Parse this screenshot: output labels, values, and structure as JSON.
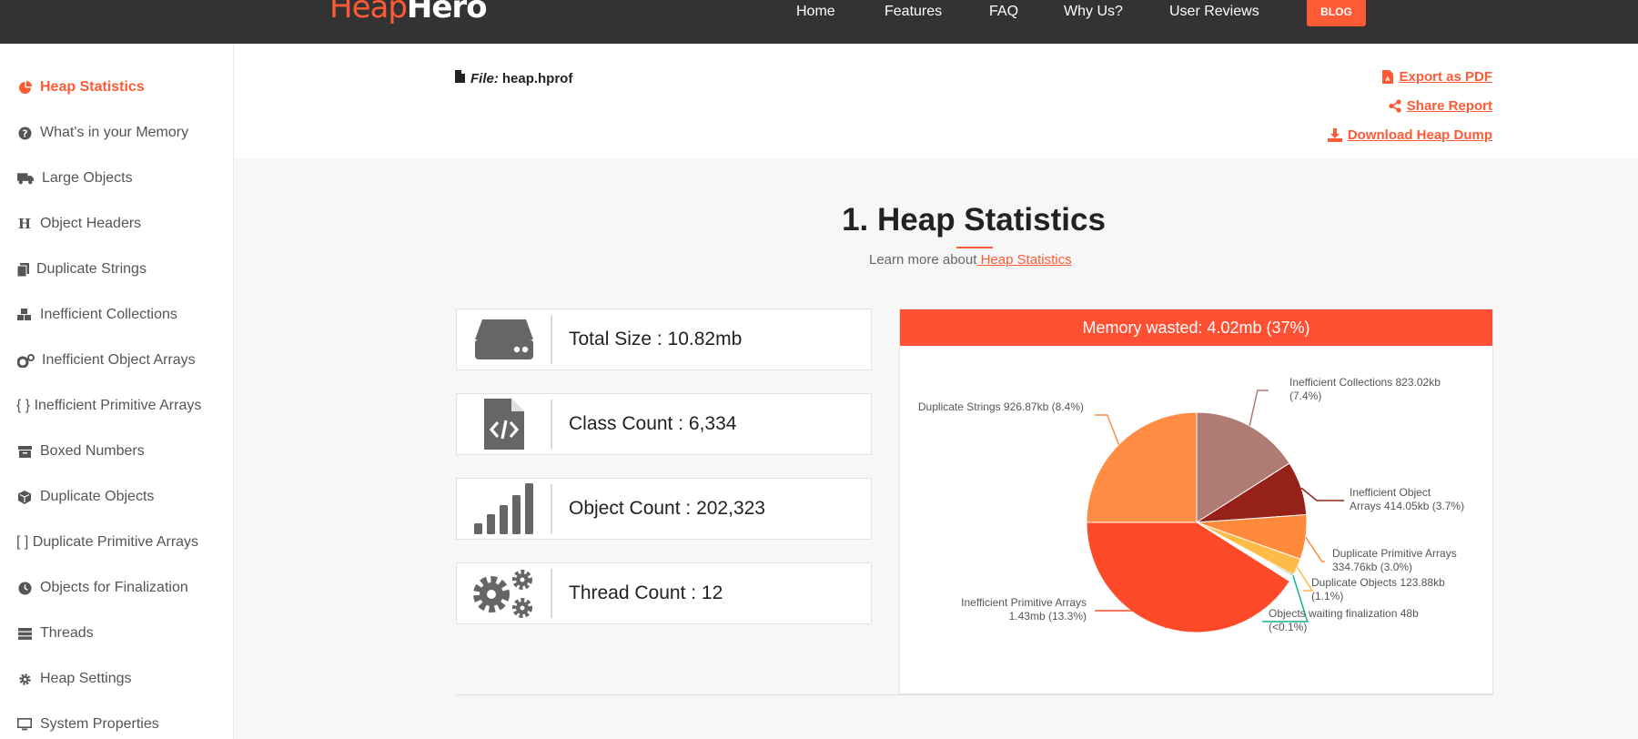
{
  "brand": {
    "part1": "Heap",
    "part2": "Hero"
  },
  "nav": {
    "items": [
      "Home",
      "Features",
      "FAQ",
      "Why Us?",
      "User Reviews"
    ],
    "blog": "BLOG"
  },
  "sidebar": {
    "items": [
      {
        "label": "Heap Statistics",
        "icon": "pie-chart-icon",
        "active": true
      },
      {
        "label": "What's in your Memory",
        "icon": "question-circle-icon"
      },
      {
        "label": "Large Objects",
        "icon": "truck-icon"
      },
      {
        "label": "Object Headers",
        "icon": "header-icon"
      },
      {
        "label": "Duplicate Strings",
        "icon": "copy-icon"
      },
      {
        "label": "Inefficient Collections",
        "icon": "cubes-icon"
      },
      {
        "label": "Inefficient Object Arrays",
        "icon": "cogs-icon"
      },
      {
        "label": "{ } Inefficient Primitive Arrays",
        "icon": "none"
      },
      {
        "label": "Boxed Numbers",
        "icon": "archive-icon"
      },
      {
        "label": "Duplicate Objects",
        "icon": "cube-icon"
      },
      {
        "label": "[ ] Duplicate Primitive Arrays",
        "icon": "none"
      },
      {
        "label": "Objects for Finalization",
        "icon": "clock-icon"
      },
      {
        "label": "Threads",
        "icon": "server-icon"
      },
      {
        "label": "Heap Settings",
        "icon": "gear-icon"
      },
      {
        "label": "System Properties",
        "icon": "monitor-icon"
      }
    ]
  },
  "file": {
    "prefix": "File:",
    "name": "heap.hprof"
  },
  "actions": {
    "export": "Export as PDF",
    "share": "Share Report",
    "download": "Download Heap Dump"
  },
  "section": {
    "title": "1. Heap Statistics",
    "learn_prefix": "Learn more about",
    "learn_link": " Heap Statistics"
  },
  "stats": [
    {
      "text": "Total Size : 10.82mb",
      "icon": "hdd-icon"
    },
    {
      "text": "Class Count : 6,334",
      "icon": "file-code-icon"
    },
    {
      "text": "Object Count : 202,323",
      "icon": "signal-bars-icon"
    },
    {
      "text": "Thread Count : 12",
      "icon": "gears-icon"
    }
  ],
  "colors": {
    "accent": "#ff5a36",
    "topbar": "#333333"
  },
  "chart_data": {
    "type": "pie",
    "title": "Memory wasted: 4.02mb (37%)",
    "slices": [
      {
        "label": "Inefficient Collections 823.02kb (7.4%)",
        "label_lines": [
          "Inefficient Collections 823.02kb",
          "(7.4%)"
        ],
        "value": 7.4,
        "color": "#b07b72"
      },
      {
        "label": "Inefficient Object Arrays 414.05kb (3.7%)",
        "label_lines": [
          "Inefficient Object",
          "Arrays 414.05kb (3.7%)"
        ],
        "value": 3.7,
        "color": "#962118"
      },
      {
        "label": "Duplicate Primitive Arrays 334.76kb (3.0%)",
        "label_lines": [
          "Duplicate Primitive Arrays",
          "334.76kb (3.0%)"
        ],
        "value": 3.0,
        "color": "#ff8a3c"
      },
      {
        "label": "Duplicate Objects 123.88kb (1.1%)",
        "label_lines": [
          "Duplicate Objects 123.88kb",
          "(1.1%)"
        ],
        "value": 1.1,
        "color": "#ffbb48"
      },
      {
        "label": "Objects waiting finalization 48b (<0.1%)",
        "label_lines": [
          "Objects waiting finalization 48b",
          "(<0.1%)"
        ],
        "value": 0.05,
        "color": "#14b28c"
      },
      {
        "label": "Inefficient Primitive Arrays 1.43mb (13.3%)",
        "label_lines": [
          "Inefficient Primitive Arrays",
          "1.43mb (13.3%)"
        ],
        "value": 13.3,
        "color": "#ff4a2a"
      },
      {
        "label": "Duplicate Strings 926.87kb (8.4%)",
        "label_lines": [
          "Duplicate Strings 926.87kb (8.4%)"
        ],
        "value": 8.4,
        "color": "#ff8c42"
      }
    ]
  }
}
